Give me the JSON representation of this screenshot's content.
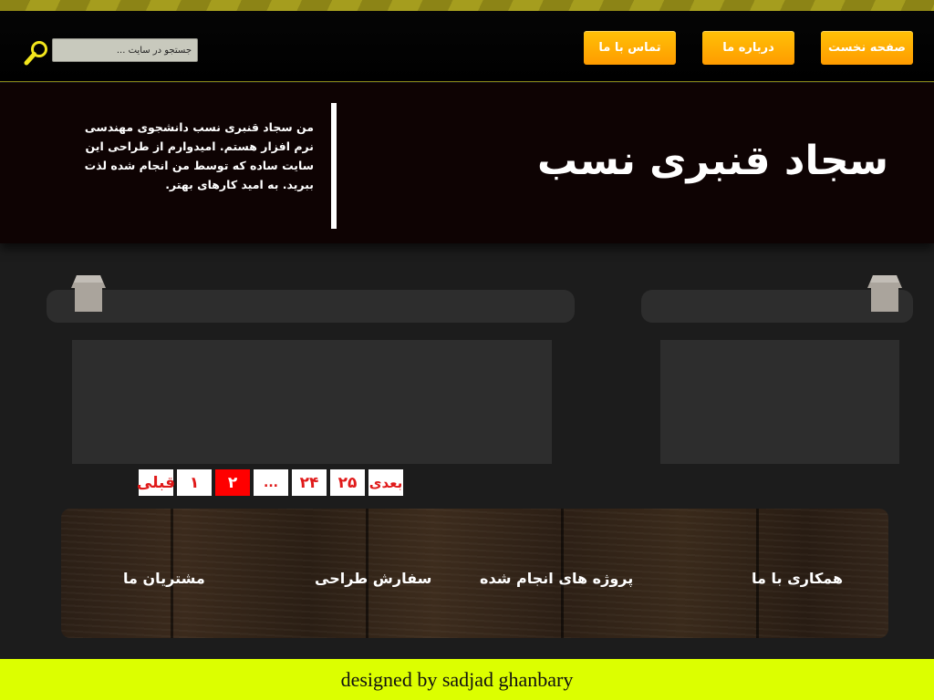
{
  "nav": {
    "home_label": "صفحه نخست",
    "about_label": "درباره ما",
    "contact_label": "تماس با ما"
  },
  "search": {
    "placeholder": "جستجو در سایت ..."
  },
  "hero": {
    "title": "سجاد قنبری نسب",
    "intro": "من سجاد قنبری نسب دانشجوی مهندسی نرم افزار هستم. امیدوارم از طراحی این سایت ساده که توسط من انجام شده لذت ببرید. به امید کارهای بهتر."
  },
  "pagination": {
    "next_label": "بعدی",
    "prev_label": "قبلی",
    "pages": [
      "۲۵",
      "۲۴",
      "...",
      "۲",
      "۱"
    ],
    "current": "۲"
  },
  "footer_links": {
    "cooperation": "همکاری با ما",
    "projects": "پروژه های انجام شده",
    "order_design": "سفارش طراحی",
    "customers": "مشتریان ما"
  },
  "footer": {
    "credit": "designed by sadjad ghanbary"
  },
  "colors": {
    "accent": "#ffb000",
    "footer_bg": "#dcff00",
    "pager_active": "#ff0000"
  }
}
